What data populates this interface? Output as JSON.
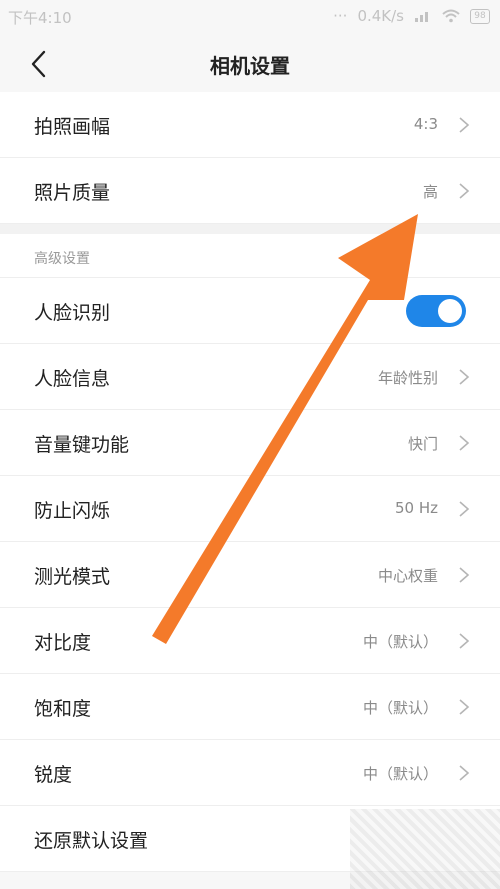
{
  "status_bar": {
    "time": "下午4:10",
    "dots": "···",
    "speed": "0.4K/s",
    "battery": "98"
  },
  "header": {
    "title": "相机设置"
  },
  "settings": {
    "rows_top": [
      {
        "label": "拍照画幅",
        "value": "4:3"
      },
      {
        "label": "照片质量",
        "value": "高"
      }
    ],
    "advanced_section_title": "高级设置",
    "face_recognition": {
      "label": "人脸识别",
      "enabled": true
    },
    "rows_advanced": [
      {
        "label": "人脸信息",
        "value": "年龄性别"
      },
      {
        "label": "音量键功能",
        "value": "快门"
      },
      {
        "label": "防止闪烁",
        "value": "50 Hz"
      },
      {
        "label": "测光模式",
        "value": "中心权重"
      },
      {
        "label": "对比度",
        "value": "中（默认）"
      },
      {
        "label": "饱和度",
        "value": "中（默认）"
      },
      {
        "label": "锐度",
        "value": "中（默认）"
      }
    ],
    "reset_label": "还原默认设置"
  },
  "colors": {
    "toggle_on": "#1f86e8",
    "arrow": "#f47a2a"
  },
  "icons": {
    "back": "chevron-left-icon",
    "row": "chevron-right-icon"
  }
}
